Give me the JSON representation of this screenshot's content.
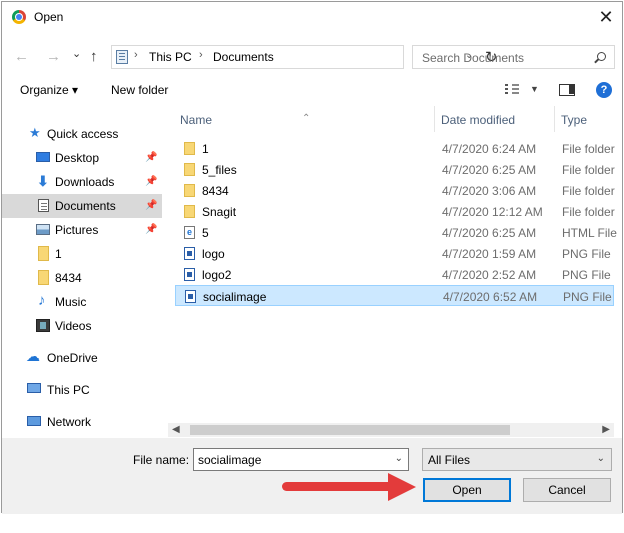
{
  "window": {
    "title": "Open",
    "close_glyph": "✕"
  },
  "nav": {
    "back_glyph": "←",
    "forward_glyph": "→",
    "recent_glyph": "⌄",
    "up_glyph": "↑",
    "breadcrumb": [
      "This PC",
      "Documents"
    ],
    "breadcrumb_sep": "›",
    "refresh_glyph": "↻",
    "search_placeholder": "Search Documents"
  },
  "toolbar": {
    "organize_label": "Organize ▾",
    "new_folder_label": "New folder",
    "help_label": "?"
  },
  "sidebar": {
    "items": [
      {
        "label": "Quick access",
        "icon": "star-icon"
      },
      {
        "label": "Desktop",
        "icon": "desktop-icon",
        "pinned": true
      },
      {
        "label": "Downloads",
        "icon": "download-icon",
        "pinned": true
      },
      {
        "label": "Documents",
        "icon": "document-icon",
        "pinned": true,
        "selected": true
      },
      {
        "label": "Pictures",
        "icon": "pictures-icon",
        "pinned": true
      },
      {
        "label": "1",
        "icon": "folder-icon"
      },
      {
        "label": "8434",
        "icon": "folder-icon"
      },
      {
        "label": "Music",
        "icon": "music-icon"
      },
      {
        "label": "Videos",
        "icon": "video-icon"
      },
      {
        "label": "OneDrive",
        "icon": "cloud-icon"
      },
      {
        "label": "This PC",
        "icon": "computer-icon"
      },
      {
        "label": "Network",
        "icon": "network-icon"
      }
    ]
  },
  "columns": {
    "name": "Name",
    "date": "Date modified",
    "type": "Type"
  },
  "files": [
    {
      "name": "1",
      "date": "4/7/2020 6:24 AM",
      "type": "File folder",
      "icon": "folder"
    },
    {
      "name": "5_files",
      "date": "4/7/2020 6:25 AM",
      "type": "File folder",
      "icon": "folder"
    },
    {
      "name": "8434",
      "date": "4/7/2020 3:06 AM",
      "type": "File folder",
      "icon": "folder"
    },
    {
      "name": "Snagit",
      "date": "4/7/2020 12:12 AM",
      "type": "File folder",
      "icon": "folder"
    },
    {
      "name": "5",
      "date": "4/7/2020 6:25 AM",
      "type": "HTML File",
      "icon": "html"
    },
    {
      "name": "logo",
      "date": "4/7/2020 1:59 AM",
      "type": "PNG File",
      "icon": "png"
    },
    {
      "name": "logo2",
      "date": "4/7/2020 2:52 AM",
      "type": "PNG File",
      "icon": "png"
    },
    {
      "name": "socialimage",
      "date": "4/7/2020 6:52 AM",
      "type": "PNG File",
      "icon": "png",
      "selected": true
    }
  ],
  "bottom": {
    "filename_label": "File name:",
    "filename_value": "socialimage",
    "filter_value": "All Files",
    "open_label": "Open",
    "cancel_label": "Cancel"
  },
  "colors": {
    "accent": "#0078d7",
    "selection": "#cce8ff",
    "annotation_arrow": "#e33b3b"
  }
}
